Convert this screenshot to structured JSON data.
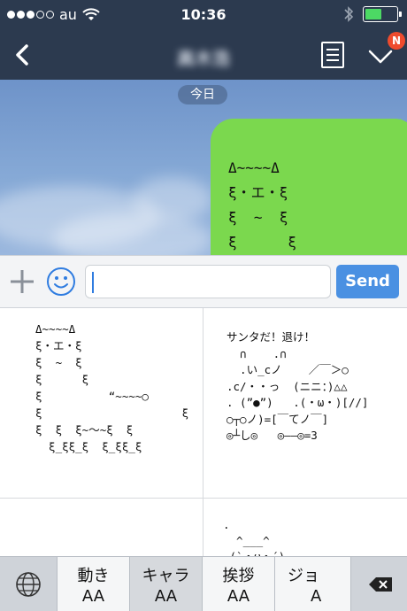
{
  "status_bar": {
    "carrier": "au",
    "time": "10:36"
  },
  "nav": {
    "chat_title": "高木浩",
    "badge": "N"
  },
  "chat": {
    "date_label": "今日",
    "bubble_text": "Δ~~~~Δ\nξ・エ・ξ\nξ  ~  ξ\nξ      ξ"
  },
  "input": {
    "placeholder": "",
    "value": "",
    "send_label": "Send"
  },
  "emoticons": [
    "Δ~~~~Δ\nξ・エ・ξ\nξ  ~  ξ\nξ      ξ\nξ          “~~~~○\nξ                     ξ\nξ  ξ  ξ~〜~ξ  ξ\n  ξ_ξξ_ξ  ξ_ξξ_ξ",
    "サンタだ！退け！\n  ∩    .∩\n  .い_cノ    ／￣＞○\n.c/・・っ  (ニニ：)△△\n. (”●”)   .(・ω・)[//]\n○┬○ノ)=[￣てノ￣]\n◎┴し◎   ◎――◎=3",
    ".\n  ^___^\n (`・ω・´)"
  ],
  "categories": [
    {
      "label": "動き",
      "sub": "AA"
    },
    {
      "label": "キャラ",
      "sub": "AA"
    },
    {
      "label": "挨拶",
      "sub": "AA"
    },
    {
      "label": "ジョ",
      "sub": "A"
    }
  ],
  "icons": {
    "back": "chevron-left-icon",
    "notes": "notes-icon",
    "menu": "chevron-down-icon",
    "add": "plus-icon",
    "emoticon": "smiley-icon",
    "keyboard": "globe-icon",
    "delete": "backspace-icon"
  },
  "colors": {
    "header": "#2c3a4f",
    "bubble": "#7bd84e",
    "send": "#4a90e2",
    "badge": "#ef4b2d"
  }
}
